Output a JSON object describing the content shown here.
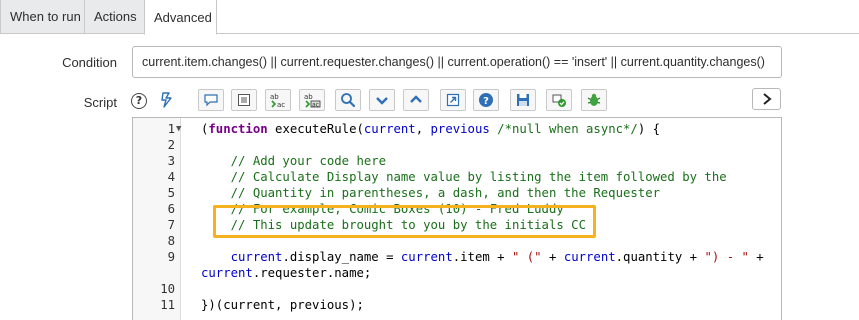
{
  "tabs": [
    {
      "label": "When to run"
    },
    {
      "label": "Actions"
    },
    {
      "label": "Advanced"
    }
  ],
  "condition": {
    "label": "Condition",
    "value": "current.item.changes() || current.requester.changes() || current.operation() == 'insert' || current.quantity.changes()"
  },
  "script": {
    "label": "Script",
    "help_icon": "?",
    "toolbar_icons": [
      "format-code-icon",
      "comment-icon",
      "document-icon",
      "replace-icon",
      "replace-all-icon",
      "search-icon",
      "chevron-down-icon",
      "chevron-up-icon",
      "open-external-icon",
      "help-icon",
      "save-icon",
      "script-check-icon",
      "debug-icon"
    ],
    "expand_icon": "chevron-right-icon"
  },
  "editor": {
    "lines": [
      {
        "n": "1",
        "fold": true,
        "segments": [
          {
            "t": "(",
            "c": "fn"
          },
          {
            "t": "function",
            "c": "kw"
          },
          {
            "t": " executeRule(",
            "c": "fn"
          },
          {
            "t": "current",
            "c": "var"
          },
          {
            "t": ", ",
            "c": "fn"
          },
          {
            "t": "previous",
            "c": "var"
          },
          {
            "t": " /*null when async*/",
            "c": "cm"
          },
          {
            "t": ") {",
            "c": "fn"
          }
        ]
      },
      {
        "n": "2",
        "segments": []
      },
      {
        "n": "3",
        "segments": [
          {
            "t": "    // Add your code here",
            "c": "cm"
          }
        ]
      },
      {
        "n": "4",
        "segments": [
          {
            "t": "    // Calculate Display name value by listing the item followed by the",
            "c": "cm"
          }
        ]
      },
      {
        "n": "5",
        "segments": [
          {
            "t": "    // Quantity in parentheses, a dash, and then the Requester",
            "c": "cm"
          }
        ]
      },
      {
        "n": "6",
        "segments": [
          {
            "t": "    // For example, Comic Boxes (10) - Fred Luddy",
            "c": "cm"
          }
        ]
      },
      {
        "n": "7",
        "segments": [
          {
            "t": "    // This update brought to you by the initials CC",
            "c": "cm"
          }
        ]
      },
      {
        "n": "8",
        "segments": []
      },
      {
        "n": "9",
        "segments": [
          {
            "t": "    current",
            "c": "var"
          },
          {
            "t": ".display_name = ",
            "c": "fn"
          },
          {
            "t": "current",
            "c": "var"
          },
          {
            "t": ".item + ",
            "c": "fn"
          },
          {
            "t": "\" (\"",
            "c": "str"
          },
          {
            "t": " + ",
            "c": "fn"
          },
          {
            "t": "current",
            "c": "var"
          },
          {
            "t": ".quantity + ",
            "c": "fn"
          },
          {
            "t": "\") - \"",
            "c": "str"
          },
          {
            "t": " +",
            "c": "fn"
          }
        ]
      },
      {
        "n": "",
        "segments": [
          {
            "t": "current",
            "c": "var"
          },
          {
            "t": ".requester.name;",
            "c": "fn"
          }
        ]
      },
      {
        "n": "10",
        "segments": []
      },
      {
        "n": "11",
        "segments": [
          {
            "t": "})(current, previous);",
            "c": "fn"
          }
        ]
      }
    ]
  },
  "colors": {
    "highlight": "#f5b21e",
    "tab_inactive": "#e9eaeb",
    "icon_blue": "#2f6fb5"
  }
}
